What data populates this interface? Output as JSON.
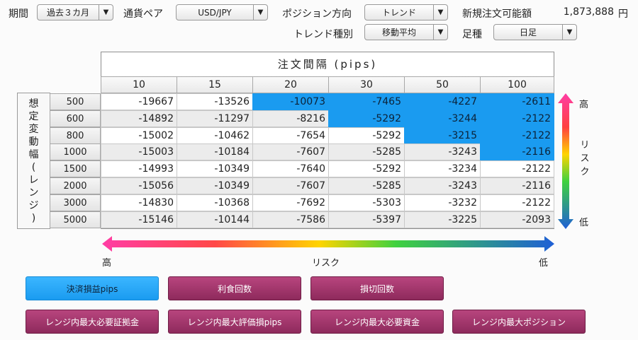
{
  "controls": {
    "period_label": "期間",
    "period_value": "過去３カ月",
    "pair_label": "通貨ペア",
    "pair_value": "USD/JPY",
    "direction_label": "ポジション方向",
    "direction_value": "トレンド",
    "available_label": "新規注文可能額",
    "available_amount": "1,873,888",
    "currency_unit": "円",
    "trend_type_label": "トレンド種別",
    "trend_type_value": "移動平均",
    "candle_label": "足種",
    "candle_value": "日足"
  },
  "table": {
    "title": "注文間隔 (pips)",
    "row_group_label": [
      "想",
      "定",
      "変",
      "動",
      "幅",
      "(",
      "レ",
      "ン",
      "ジ",
      ")"
    ],
    "columns": [
      "10",
      "15",
      "20",
      "30",
      "50",
      "100"
    ],
    "rows": [
      {
        "range": "500",
        "values": [
          "-19667",
          "-13526",
          "-10073",
          "-7465",
          "-4227",
          "-2611"
        ],
        "highlight": [
          false,
          false,
          true,
          true,
          true,
          true
        ]
      },
      {
        "range": "600",
        "values": [
          "-14892",
          "-11297",
          "-8216",
          "-5292",
          "-3244",
          "-2122"
        ],
        "highlight": [
          false,
          false,
          false,
          true,
          true,
          true
        ]
      },
      {
        "range": "800",
        "values": [
          "-15002",
          "-10462",
          "-7654",
          "-5292",
          "-3215",
          "-2122"
        ],
        "highlight": [
          false,
          false,
          false,
          false,
          true,
          true
        ]
      },
      {
        "range": "1000",
        "values": [
          "-15003",
          "-10184",
          "-7607",
          "-5285",
          "-3243",
          "-2116"
        ],
        "highlight": [
          false,
          false,
          false,
          false,
          false,
          true
        ]
      },
      {
        "range": "1500",
        "values": [
          "-14993",
          "-10349",
          "-7640",
          "-5292",
          "-3234",
          "-2122"
        ],
        "highlight": [
          false,
          false,
          false,
          false,
          false,
          false
        ]
      },
      {
        "range": "2000",
        "values": [
          "-15056",
          "-10349",
          "-7607",
          "-5285",
          "-3243",
          "-2116"
        ],
        "highlight": [
          false,
          false,
          false,
          false,
          false,
          false
        ]
      },
      {
        "range": "3000",
        "values": [
          "-14830",
          "-10368",
          "-7692",
          "-5303",
          "-3232",
          "-2122"
        ],
        "highlight": [
          false,
          false,
          false,
          false,
          false,
          false
        ]
      },
      {
        "range": "5000",
        "values": [
          "-15146",
          "-10144",
          "-7586",
          "-5397",
          "-3225",
          "-2093"
        ],
        "highlight": [
          false,
          false,
          false,
          false,
          false,
          false
        ]
      }
    ]
  },
  "risk": {
    "high": "高",
    "low": "低",
    "label": "リスク",
    "vertical_label": [
      "リ",
      "ス",
      "ク"
    ]
  },
  "buttons": [
    {
      "label": "決済損益pips",
      "active": true
    },
    {
      "label": "利食回数",
      "active": false
    },
    {
      "label": "損切回数",
      "active": false
    },
    {
      "label": "レンジ内最大必要証拠金",
      "active": false
    },
    {
      "label": "レンジ内最大評価損pips",
      "active": false
    },
    {
      "label": "レンジ内最大必要資金",
      "active": false
    },
    {
      "label": "レンジ内最大ポジション",
      "active": false
    }
  ],
  "colors": {
    "highlight": "#1a9bf0",
    "button": "#a33a6e",
    "gradient_high": "#ff3da5",
    "gradient_low": "#1f5fd6"
  }
}
